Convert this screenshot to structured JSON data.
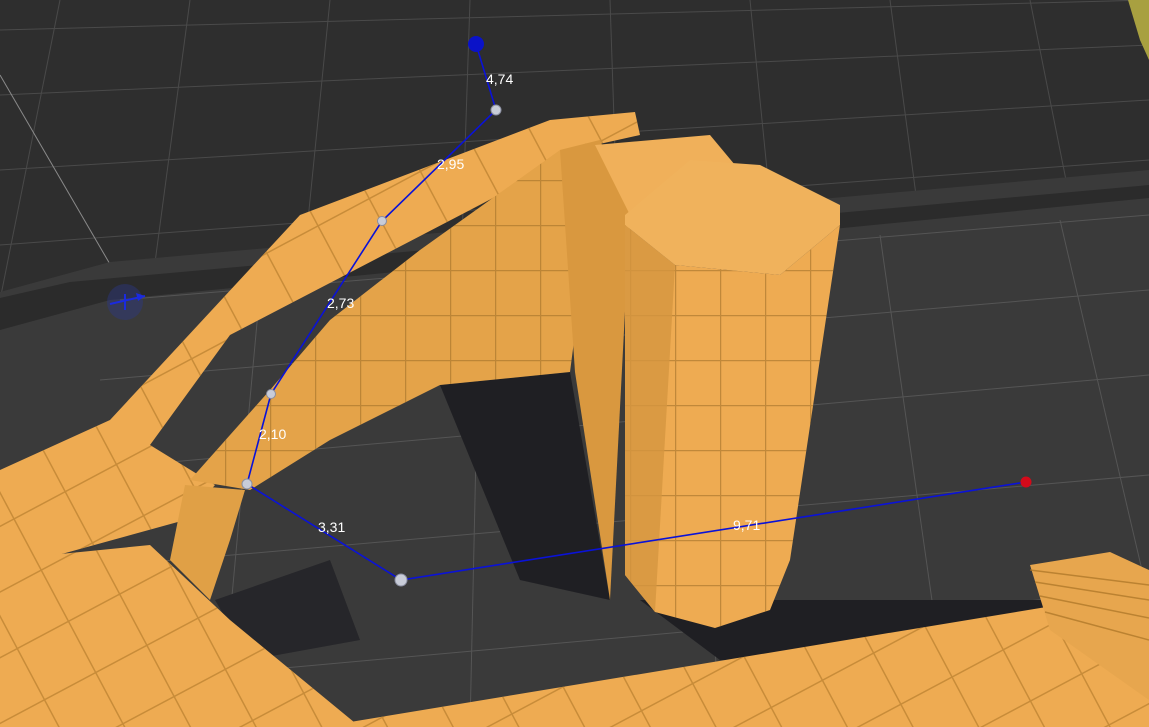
{
  "scene": {
    "colors": {
      "ground": "#2e2e2e",
      "floor": "#3a3a3a",
      "grid_line": "#5a5a5a",
      "shadow": "#1f1f23",
      "wall_top": "#eeab52",
      "wall_side": "#e4a349",
      "wall_dark": "#c88c38",
      "tile_line": "#9a6b26",
      "path_line": "#0a12d8",
      "path_start": "#0a12c8",
      "path_end": "#d40a1a",
      "waypoint": "#c8ccd8",
      "label": "#ffffff"
    }
  },
  "path": {
    "segment_lengths": [
      "4,74",
      "2,95",
      "2,73",
      "2,10",
      "3,31",
      "9,71"
    ],
    "start_marker": "agent-start-icon",
    "end_marker": "destination-icon"
  },
  "gizmo": {
    "icon": "transform-gizmo-icon"
  }
}
